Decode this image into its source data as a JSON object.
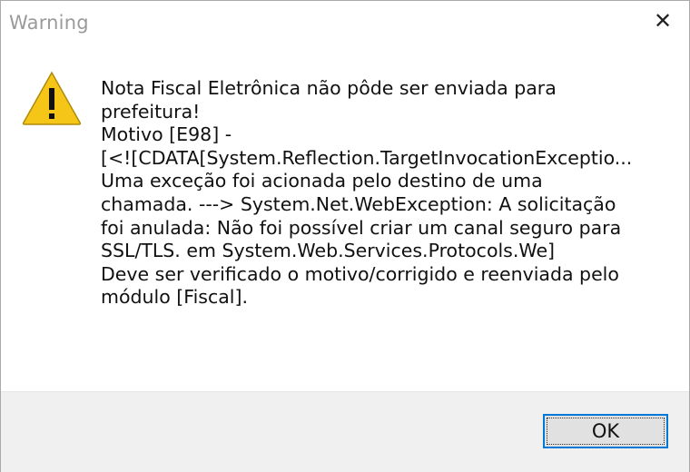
{
  "window": {
    "title": "Warning",
    "close_icon": "close-icon"
  },
  "message": {
    "icon": "warning-triangle-icon",
    "lines": [
      "Nota Fiscal Eletrônica não pôde ser enviada para",
      "prefeitura!",
      "Motivo [E98] -",
      "[<![CDATA[System.Reflection.TargetInvocationExceptio...",
      "Uma exceção foi acionada pelo destino de uma",
      "chamada. ---> System.Net.WebException: A solicitação",
      "foi anulada: Não foi possível criar um canal seguro para",
      "SSL/TLS.    em System.Web.Services.Protocols.We]",
      "Deve ser verificado o motivo/corrigido e reenviada pelo",
      "módulo [Fiscal]."
    ]
  },
  "buttons": {
    "ok_label": "OK"
  },
  "colors": {
    "warning_yellow": "#f5c518",
    "focus_border": "#0078d7",
    "footer_bg": "#f0f0f0"
  }
}
